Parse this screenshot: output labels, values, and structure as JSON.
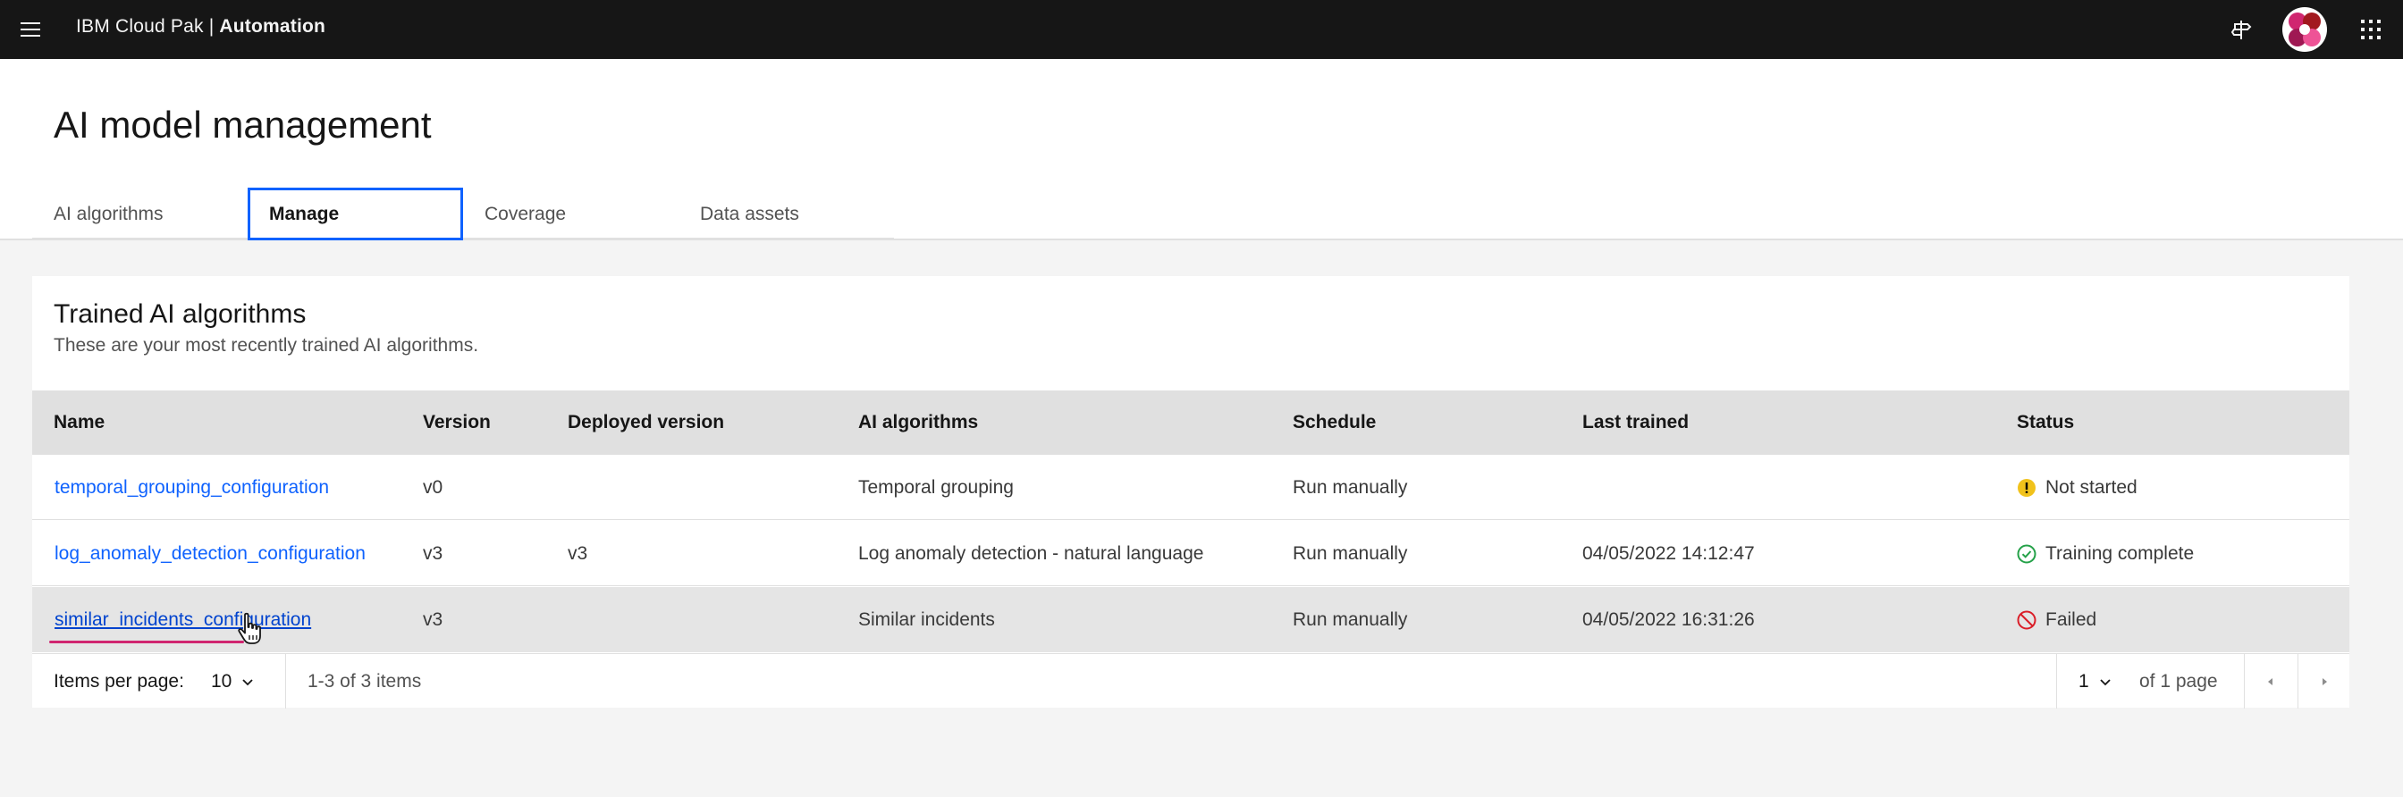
{
  "header": {
    "brand_prefix": "IBM Cloud Pak | ",
    "brand_product": "Automation",
    "icons": [
      "menu-icon",
      "signpost-icon",
      "user-avatar",
      "app-switcher-icon"
    ]
  },
  "page": {
    "title": "AI model management",
    "tabs": [
      {
        "label": "AI algorithms",
        "active": false
      },
      {
        "label": "Manage",
        "active": true
      },
      {
        "label": "Coverage",
        "active": false
      },
      {
        "label": "Data assets",
        "active": false
      }
    ]
  },
  "card": {
    "title": "Trained AI algorithms",
    "subtitle": "These are your most recently trained AI algorithms."
  },
  "table": {
    "columns": [
      "Name",
      "Version",
      "Deployed version",
      "AI algorithms",
      "Schedule",
      "Last trained",
      "Status"
    ],
    "rows": [
      {
        "name": "temporal_grouping_configuration",
        "version": "v0",
        "deployed_version": "",
        "algorithm": "Temporal grouping",
        "schedule": "Run manually",
        "last_trained": "",
        "status": "Not started",
        "status_icon": "warning-icon",
        "status_color": "#f1c21b"
      },
      {
        "name": "log_anomaly_detection_configuration",
        "version": "v3",
        "deployed_version": "v3",
        "algorithm": "Log anomaly detection - natural language",
        "schedule": "Run manually",
        "last_trained": "04/05/2022 14:12:47",
        "status": "Training complete",
        "status_icon": "checkmark-outline-icon",
        "status_color": "#24a148"
      },
      {
        "name": "similar_incidents_configuration",
        "version": "v3",
        "deployed_version": "",
        "algorithm": "Similar incidents",
        "schedule": "Run manually",
        "last_trained": "04/05/2022 16:31:26",
        "status": "Failed",
        "status_icon": "misuse-icon",
        "status_color": "#da1e28"
      }
    ]
  },
  "pagination": {
    "items_per_page_label": "Items per page:",
    "items_per_page_value": "10",
    "range_text": "1-3 of 3 items",
    "page_value": "1",
    "of_pages_text": "of 1 page"
  },
  "colors": {
    "header_bg": "#161616",
    "link": "#0f62fe",
    "active_tab_border": "#0f62fe",
    "annotation_underline": "#d02670"
  }
}
